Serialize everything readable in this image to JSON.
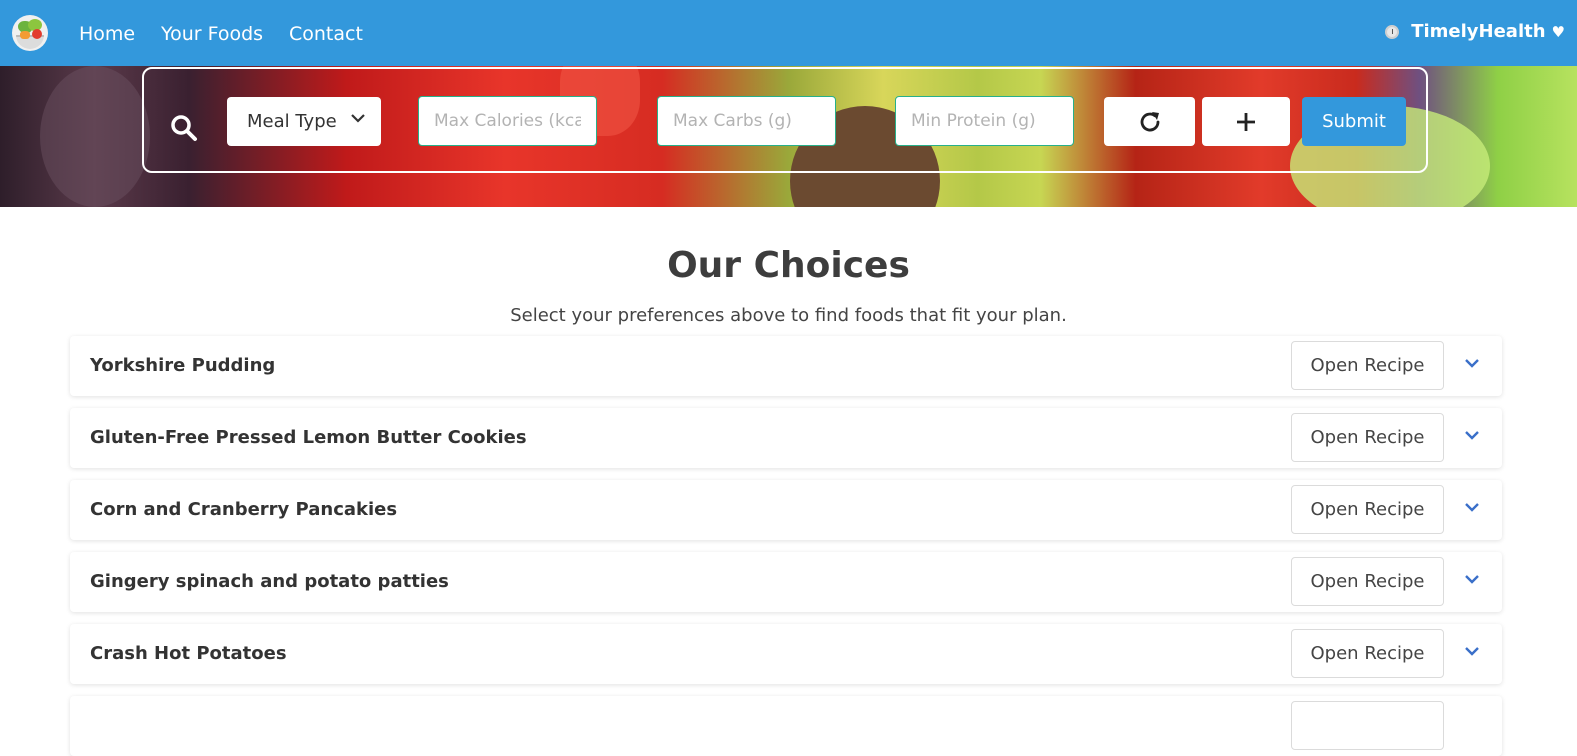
{
  "nav": {
    "links": [
      "Home",
      "Your Foods",
      "Contact"
    ],
    "brand": "TimelyHealth",
    "heart_icon": "heart-icon",
    "clock_icon": "clock-icon"
  },
  "search": {
    "meal_type_label": "Meal Type",
    "max_calories_placeholder": "Max Calories (kcal)",
    "max_carbs_placeholder": "Max Carbs (g)",
    "min_protein_placeholder": "Min Protein (g)",
    "submit_label": "Submit",
    "icons": [
      "search-icon",
      "chevron-down-icon",
      "refresh-icon",
      "plus-icon"
    ]
  },
  "main": {
    "title": "Our Choices",
    "subtitle": "Select your preferences above to find foods that fit your plan.",
    "open_label": "Open Recipe",
    "foods": [
      "Yorkshire Pudding",
      "Gluten-Free Pressed Lemon Butter Cookies",
      "Corn and Cranberry Pancakies",
      "Gingery spinach and potato patties",
      "Crash Hot Potatoes"
    ]
  },
  "colors": {
    "primary": "#3398dc",
    "input_border": "#27b08a",
    "expand_chevron": "#3a6fc9"
  }
}
